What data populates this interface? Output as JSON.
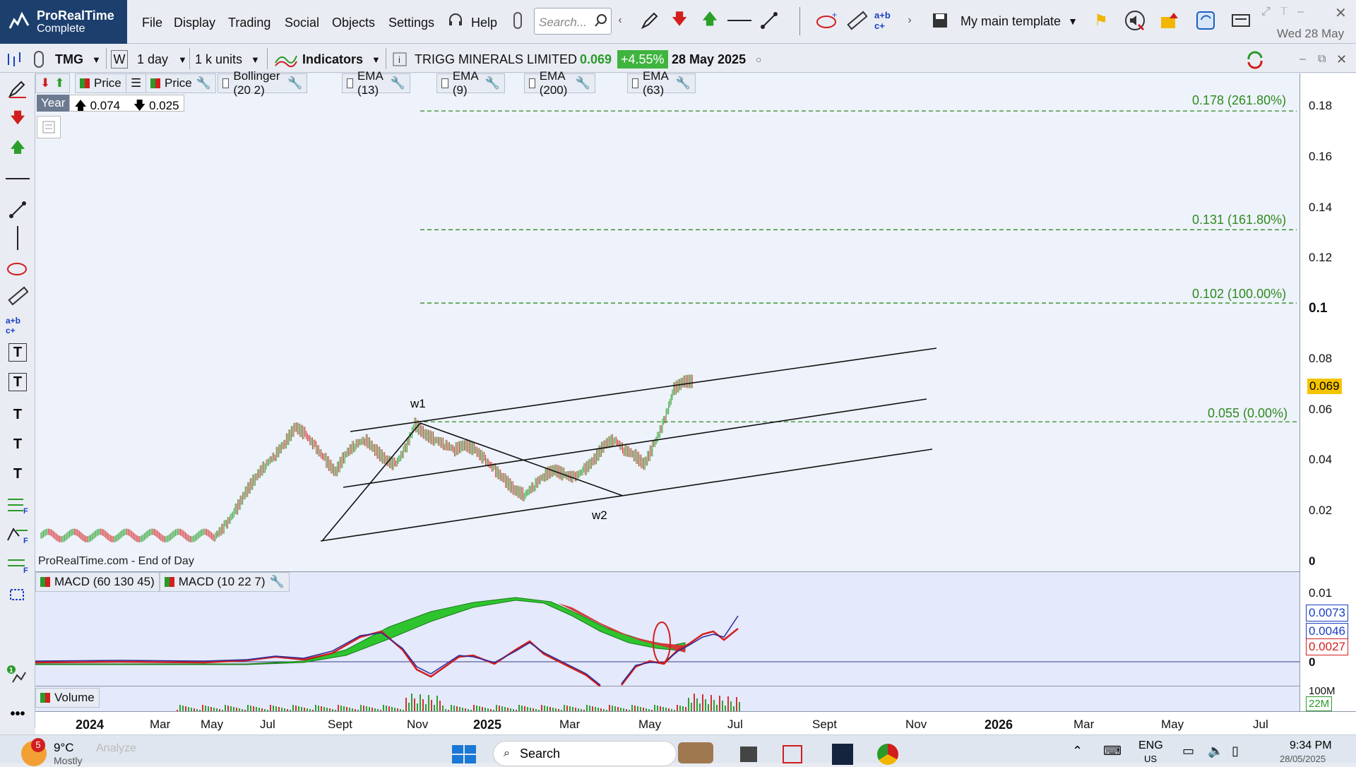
{
  "app": {
    "title": "ProRealTime",
    "subtitle": "Complete"
  },
  "menu": [
    "File",
    "Display",
    "Trading",
    "Social",
    "Objects",
    "Settings"
  ],
  "help_label": "Help",
  "search": {
    "placeholder": "Search..."
  },
  "template_label": "My main template",
  "header_date": "Wed 28 May",
  "toolbar2": {
    "ticker": "TMG",
    "w_label": "W",
    "period": "1 day",
    "units": "1 k units",
    "indicators": "Indicators",
    "instrument": "TRIGG MINERALS LIMITED",
    "last_price": "0.069",
    "change": "+4.55%",
    "date": "28 May 2025"
  },
  "legend": {
    "items": [
      "Price",
      "Price",
      "Bollinger (20 2)",
      "EMA (13)",
      "EMA (9)",
      "EMA (200)",
      "EMA (63)"
    ],
    "period_label": "Year",
    "high": "0.074",
    "low": "0.025"
  },
  "chart": {
    "source_label": "ProRealTime.com - End of Day",
    "annotations": [
      "w1",
      "w2"
    ],
    "fib_levels": [
      {
        "label": "0.178 (261.80%)",
        "value": 0.178
      },
      {
        "label": "0.131 (161.80%)",
        "value": 0.131
      },
      {
        "label": "0.102 (100.00%)",
        "value": 0.102
      },
      {
        "label": "0.055 (0.00%)",
        "value": 0.055
      }
    ],
    "y_ticks": [
      "0.18",
      "0.16",
      "0.14",
      "0.12",
      "0.1",
      "0.08",
      "0.06",
      "0.04",
      "0.02",
      "0"
    ],
    "current_price_label": "0.069",
    "colors": {
      "fib": "#2e8b1e",
      "up": "#2ea02e",
      "down": "#d43030",
      "price_tag": "#f5c400"
    }
  },
  "macd": {
    "legend": [
      "MACD (60 130 45)",
      "MACD (10 22 7)"
    ],
    "y_ticks": [
      "0.01",
      "0"
    ],
    "value_labels": [
      "0.0073",
      "0.0046",
      "0.0027"
    ]
  },
  "volume": {
    "legend": "Volume",
    "axis_top": "100M",
    "axis_label": "22M"
  },
  "x_axis": [
    "2024",
    "Mar",
    "May",
    "Jul",
    "Sept",
    "Nov",
    "2025",
    "Mar",
    "May",
    "Jul",
    "Sept",
    "Nov",
    "2026",
    "Mar",
    "May",
    "Jul"
  ],
  "taskbar": {
    "weather": "9°C",
    "weather_sub": "Mostly",
    "badge": "5",
    "analyze": "Analyze",
    "search": "Search",
    "lang": "ENG",
    "lang_sub": "US",
    "time": "9:34 PM",
    "date": "28/05/2025"
  }
}
